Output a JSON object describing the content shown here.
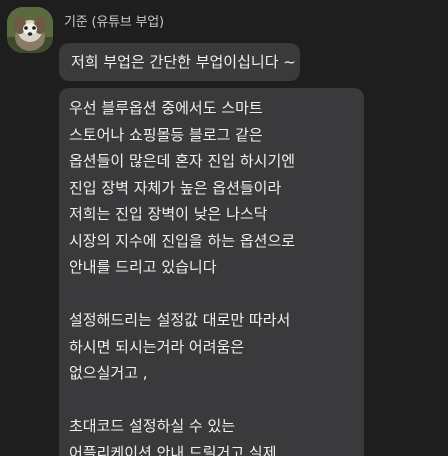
{
  "sender": {
    "name": "기준 (유튜브 부업)",
    "avatar_icon": "dog-avatar-icon"
  },
  "messages": [
    {
      "lines": [
        "저희 부업은 간단한 부업이십니다 ~"
      ]
    },
    {
      "lines": [
        "우선 블루옵션 중에서도 스마트",
        "스토어나 쇼핑몰등 블로그 같은",
        "옵션들이 많은데 혼자 진입 하시기엔",
        "진입 장벽 자체가 높은 옵션들이라",
        "저희는 진입 장벽이 낮은 나스닥",
        "시장의 지수에 진입을 하는 옵션으로",
        "안내를 드리고 있습니다",
        "",
        "설정해드리는 설정값 대로만 따라서",
        "하시면 되시는거라 어려움은",
        "없으실거고 ,",
        "",
        "초대코드 설정하실 수 있는",
        "어플리케이션 안내 드릴거고 실제"
      ]
    }
  ],
  "colors": {
    "background": "#1e1e1e",
    "bubble": "#3a3a3c",
    "text": "#f0f0f0",
    "sender_text": "#c8c8c8"
  }
}
